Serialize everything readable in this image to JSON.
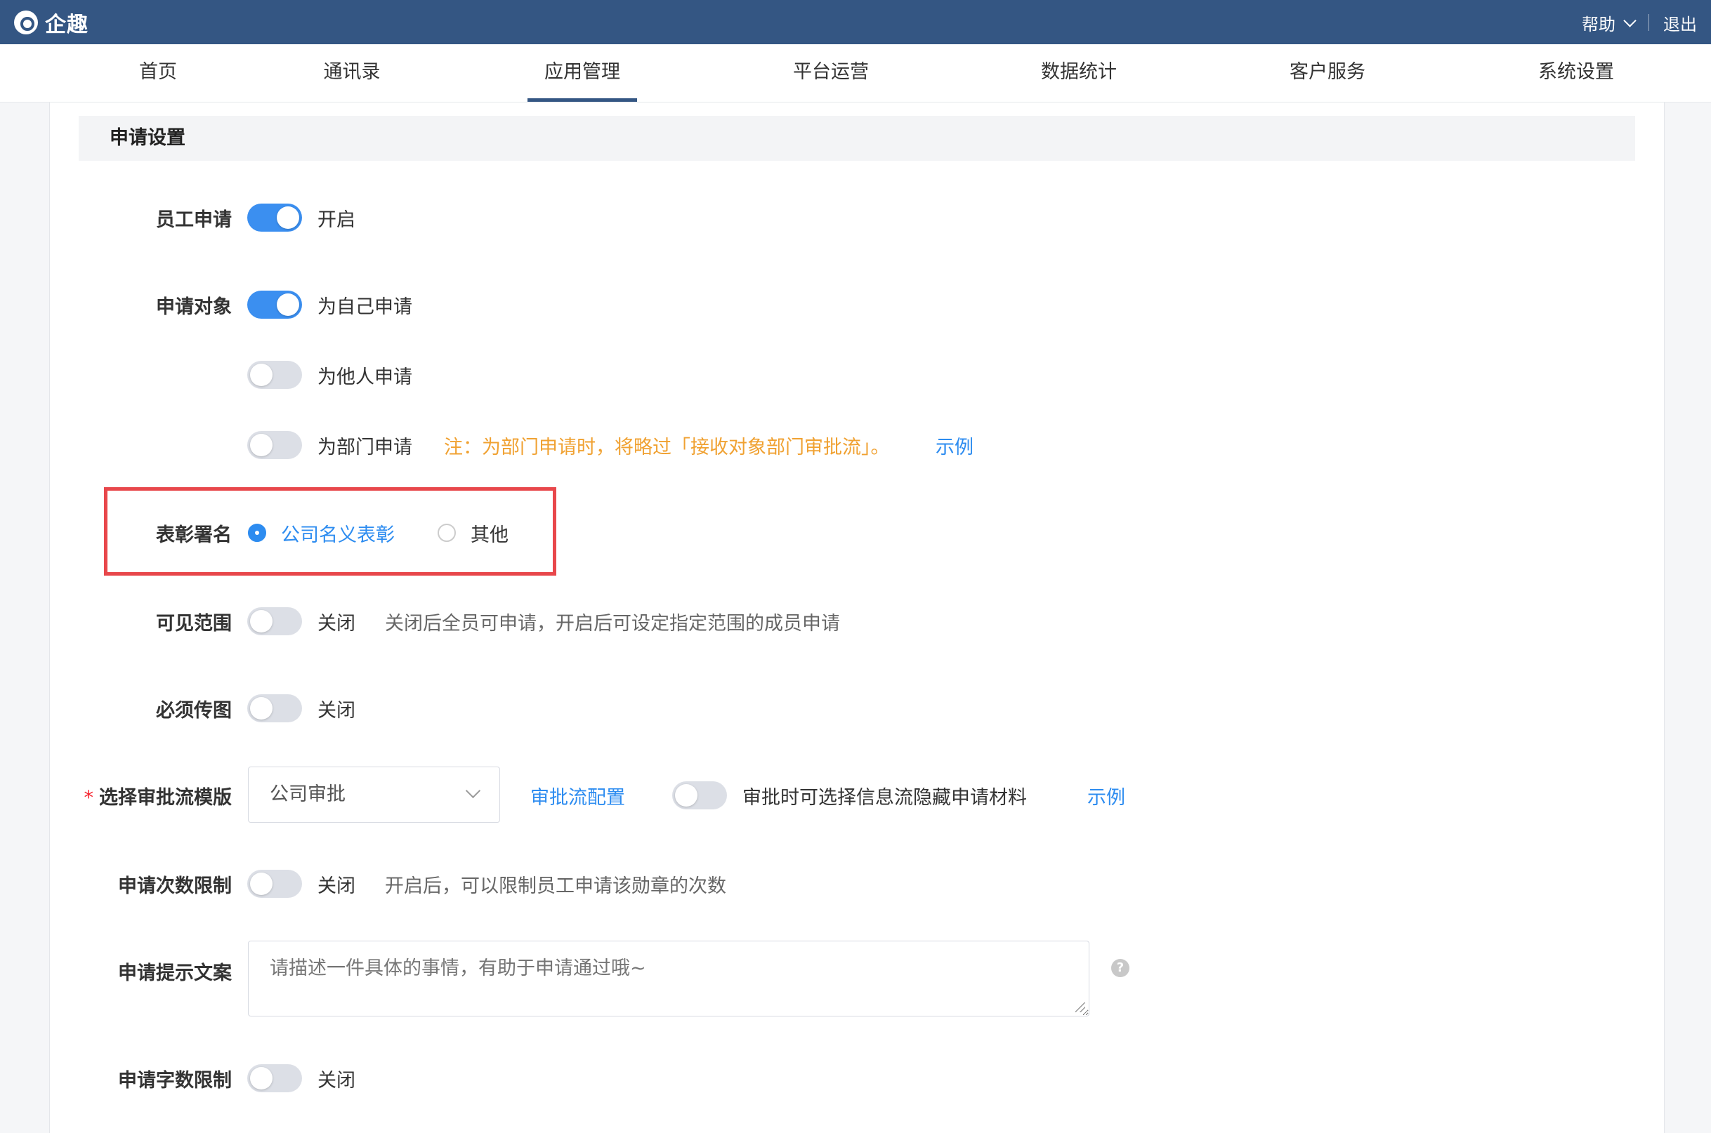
{
  "app": {
    "name": "企趣"
  },
  "topbar": {
    "help": "帮助",
    "logout": "退出"
  },
  "nav": {
    "items": [
      {
        "label": "首页"
      },
      {
        "label": "通讯录"
      },
      {
        "label": "应用管理",
        "active": true
      },
      {
        "label": "平台运营"
      },
      {
        "label": "数据统计"
      },
      {
        "label": "客户服务"
      },
      {
        "label": "系统设置"
      }
    ]
  },
  "section": {
    "title": "申请设置"
  },
  "form": {
    "employee_apply": {
      "label": "员工申请",
      "on": true,
      "state": "开启"
    },
    "apply_target": {
      "label": "申请对象",
      "options": [
        {
          "label": "为自己申请",
          "on": true
        },
        {
          "label": "为他人申请",
          "on": false
        },
        {
          "label": "为部门申请",
          "on": false
        }
      ],
      "dept_note": "注：为部门申请时，将略过「接收对象部门审批流」。",
      "example": "示例"
    },
    "signature": {
      "label": "表彰署名",
      "options": [
        {
          "label": "公司名义表彰",
          "checked": true
        },
        {
          "label": "其他",
          "checked": false
        }
      ]
    },
    "visibility": {
      "label": "可见范围",
      "on": false,
      "state": "关闭",
      "hint": "关闭后全员可申请，开启后可设定指定范围的成员申请"
    },
    "image_required": {
      "label": "必须传图",
      "on": false,
      "state": "关闭"
    },
    "approval": {
      "required_mark": "*",
      "label": "选择审批流模版",
      "selected": "公司审批",
      "config_link": "审批流配置",
      "hide_materials_label": "审批时可选择信息流隐藏申请材料",
      "hide_materials_on": false,
      "example": "示例"
    },
    "apply_count_limit": {
      "label": "申请次数限制",
      "on": false,
      "state": "关闭",
      "hint": "开启后，可以限制员工申请该勋章的次数"
    },
    "prompt_text": {
      "label": "申请提示文案",
      "placeholder": "请描述一件具体的事情，有助于申请通过哦~",
      "help": "?"
    },
    "word_limit": {
      "label": "申请字数限制",
      "on": false,
      "state": "关闭"
    }
  },
  "colors": {
    "topbar": "#345683",
    "accent": "#2d8cf0",
    "switch_on": "#3b8ff0",
    "warning": "#f0a131",
    "highlight": "#e8474b"
  }
}
